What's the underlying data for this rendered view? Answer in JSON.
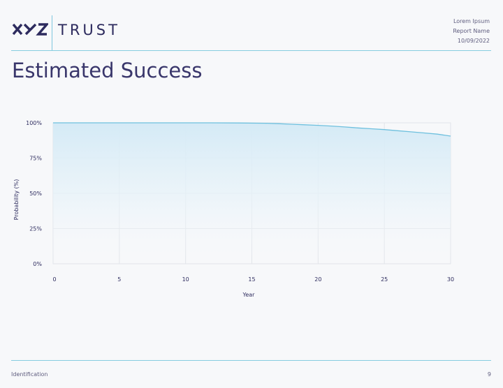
{
  "header": {
    "logo_text": "XYZ",
    "brand": "TRUST",
    "meta": [
      "Lorem Ipsum",
      "Report Name",
      "10/09/2022"
    ]
  },
  "page": {
    "title": "Estimated Success"
  },
  "footer": {
    "left": "Identification",
    "page_number": "9"
  },
  "colors": {
    "accent": "#7fc7de",
    "line": "#6ec0de",
    "fill_top": "#d4eaf6",
    "text": "#2d2b5e"
  },
  "chart_data": {
    "type": "area",
    "xlabel": "Year",
    "ylabel": "Probability (%)",
    "xlim": [
      0,
      30
    ],
    "ylim": [
      0,
      100
    ],
    "x_ticks": [
      0,
      5,
      10,
      15,
      20,
      25,
      30
    ],
    "y_ticks": [
      0,
      25,
      50,
      75,
      100
    ],
    "y_tick_labels": [
      "0%",
      "25%",
      "50%",
      "75%",
      "100%"
    ],
    "grid": true,
    "series": [
      {
        "x": [
          0,
          2,
          4,
          6,
          8,
          10,
          12,
          14,
          16,
          17,
          18,
          19,
          20,
          21,
          22,
          23,
          24,
          25,
          26,
          27,
          28,
          29,
          30
        ],
        "values": [
          100,
          100,
          100,
          100,
          100,
          100,
          100,
          99.9,
          99.7,
          99.4,
          99,
          98.6,
          98.2,
          97.7,
          97.1,
          96.4,
          95.8,
          95.2,
          94.4,
          93.6,
          92.8,
          92,
          90.6
        ]
      }
    ]
  }
}
